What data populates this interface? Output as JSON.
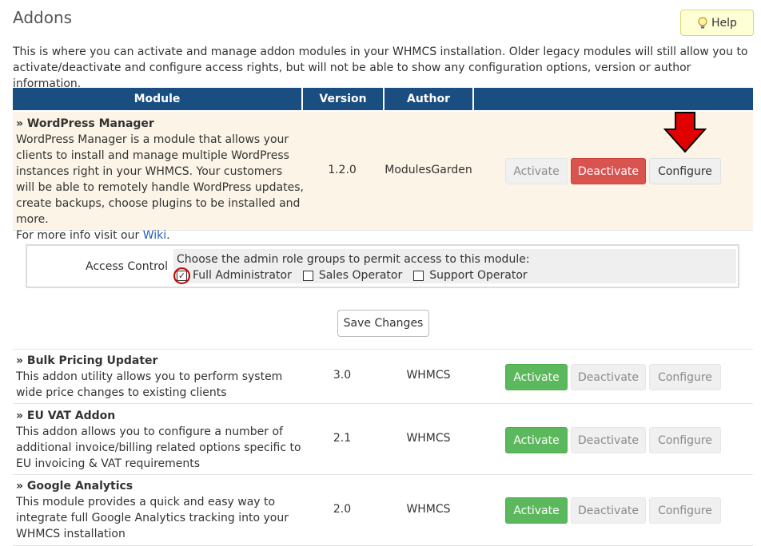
{
  "page": {
    "title": "Addons",
    "help_label": "Help",
    "intro": "This is where you can activate and manage addon modules in your WHMCS installation. Older legacy modules will still allow you to activate/deactivate and configure access rights, but will not be able to show any configuration options, version or author information."
  },
  "table": {
    "headers": [
      "Module",
      "Version",
      "Author",
      ""
    ]
  },
  "modules": [
    {
      "name": "» WordPress Manager",
      "description": "WordPress Manager is a module that allows your clients to install and manage multiple WordPress instances right in your WHMCS. Your customers will be able to remotely handle WordPress updates, create backups, choose plugins to be installed and more.",
      "more_prefix": "For more info visit our ",
      "more_link": "Wiki",
      "more_suffix": ".",
      "version": "1.2.0",
      "author": "ModulesGarden",
      "activate": "Activate",
      "deactivate": "Deactivate",
      "configure": "Configure",
      "state": "active"
    },
    {
      "name": "» Bulk Pricing Updater",
      "description": "This addon utility allows you to perform system wide price changes to existing clients",
      "version": "3.0",
      "author": "WHMCS",
      "activate": "Activate",
      "deactivate": "Deactivate",
      "configure": "Configure",
      "state": "inactive"
    },
    {
      "name": "» EU VAT Addon",
      "description": "This addon allows you to configure a number of additional invoice/billing related options specific to EU invoicing & VAT requirements",
      "version": "2.1",
      "author": "WHMCS",
      "activate": "Activate",
      "deactivate": "Deactivate",
      "configure": "Configure",
      "state": "inactive"
    },
    {
      "name": "» Google Analytics",
      "description": "This module provides a quick and easy way to integrate full Google Analytics tracking into your WHMCS installation",
      "version": "2.0",
      "author": "WHMCS",
      "activate": "Activate",
      "deactivate": "Deactivate",
      "configure": "Configure",
      "state": "inactive"
    }
  ],
  "access_control": {
    "label": "Access Control",
    "prompt": "Choose the admin role groups to permit access to this module:",
    "roles": [
      {
        "label": "Full Administrator",
        "checked": true
      },
      {
        "label": "Sales Operator",
        "checked": false
      },
      {
        "label": "Support Operator",
        "checked": false
      }
    ],
    "save_label": "Save Changes"
  },
  "colors": {
    "header_bg": "#1a4d80",
    "active_row_bg": "#fcf4e6",
    "deactivate_red": "#d9534f",
    "activate_green": "#5cb85c",
    "annotation_red": "#cc0000"
  },
  "icons": {
    "help": "lightbulb-icon",
    "annotation": "down-arrow-icon"
  }
}
